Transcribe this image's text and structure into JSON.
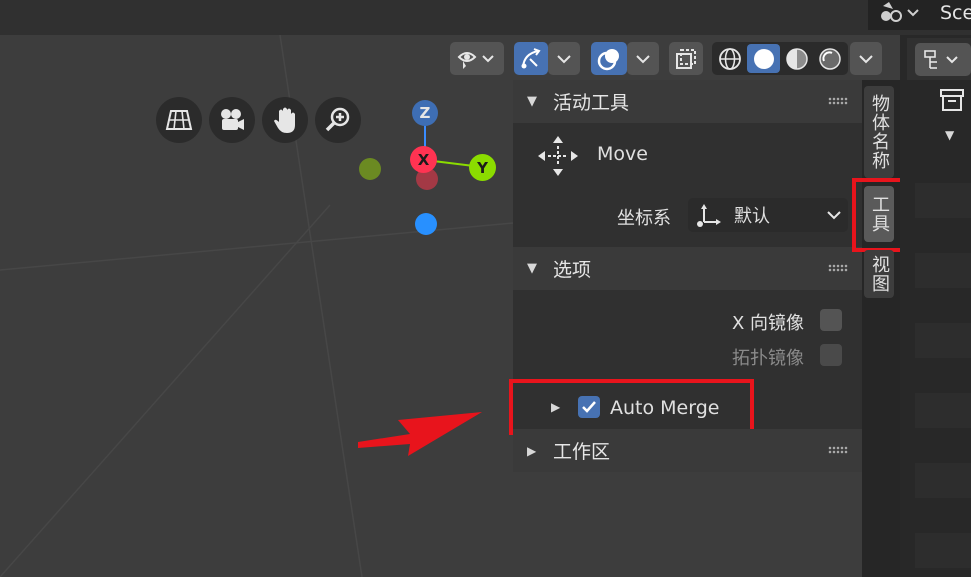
{
  "header": {
    "scene_label": "Sce"
  },
  "viewport_header": {
    "view_object_types_icon": "eye-arrow-icon",
    "gizmo_icon": "gizmo-icon",
    "overlay_icon": "overlay-icon",
    "xray_icon": "xray-icon",
    "shading_modes": [
      "wireframe-icon",
      "solid-icon",
      "material-preview-icon",
      "rendered-icon"
    ],
    "active_shading_mode": "solid-icon"
  },
  "navigation": {
    "buttons": [
      "ortho-grid-icon",
      "camera-icon",
      "hand-icon",
      "zoom-icon"
    ]
  },
  "axis_gizmo": {
    "z": "Z",
    "x": "X",
    "y": "Y",
    "colors": {
      "x": "#ff3352",
      "y": "#8bdc00",
      "z": "#2890ff"
    }
  },
  "sidebar": {
    "active_tool_panel": {
      "title": "活动工具",
      "tool_name": "Move",
      "coord_label": "坐标系",
      "coord_value": "默认"
    },
    "options_panel": {
      "title": "选项",
      "x_mirror_label": "X 向镜像",
      "x_mirror_checked": false,
      "topology_mirror_label": "拓扑镜像",
      "topology_mirror_checked": false,
      "auto_merge_label": "Auto Merge",
      "auto_merge_checked": true
    },
    "workspace_panel": {
      "title": "工作区"
    },
    "tabs": [
      {
        "label": "物体名称",
        "active": false
      },
      {
        "label": "工具",
        "active": true
      },
      {
        "label": "视图",
        "active": false
      }
    ]
  },
  "colors": {
    "accent": "#4772b3",
    "highlight_box": "#e8141c"
  }
}
